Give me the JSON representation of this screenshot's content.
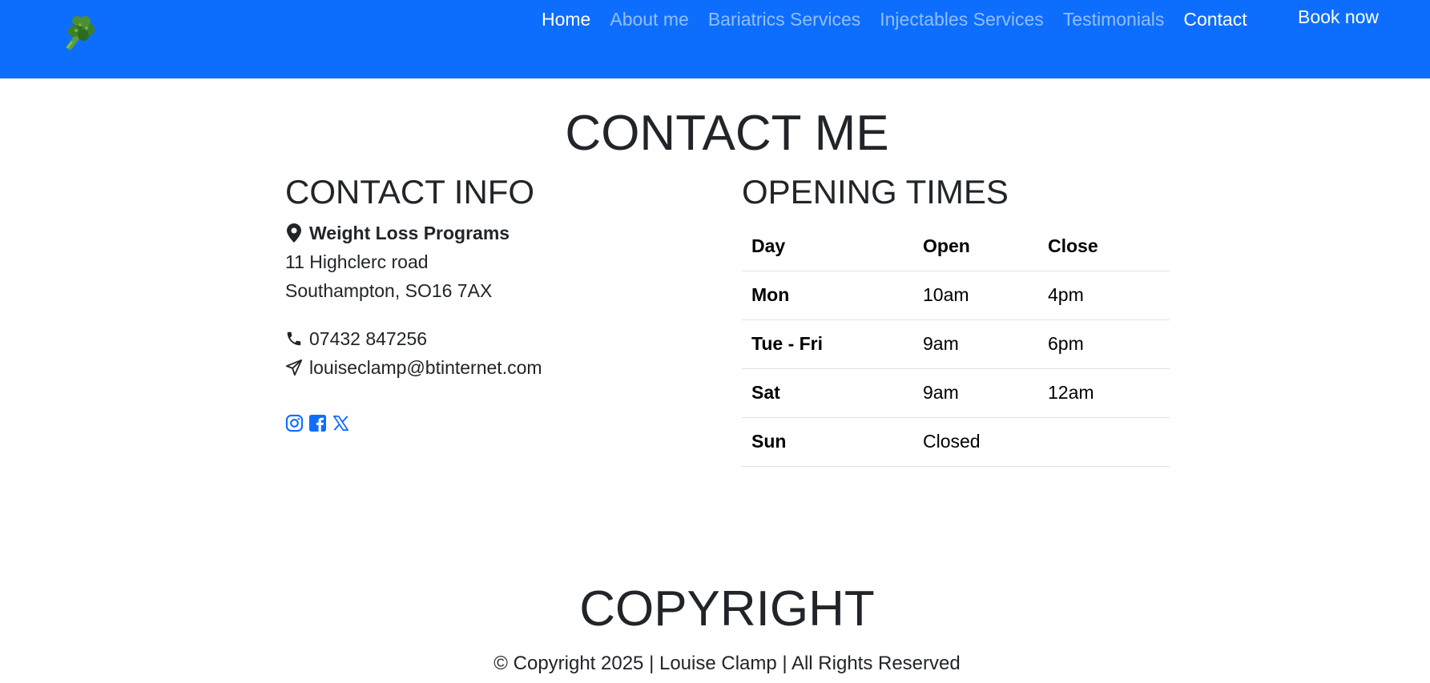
{
  "nav": {
    "logo_icon": "broccoli-icon",
    "links": [
      {
        "label": "Home",
        "active": true
      },
      {
        "label": "About me",
        "active": false
      },
      {
        "label": "Bariatrics Services",
        "active": false
      },
      {
        "label": "Injectables Services",
        "active": false
      },
      {
        "label": "Testimonials",
        "active": false
      },
      {
        "label": "Contact",
        "active": true
      }
    ],
    "book_label": "Book now",
    "background_color": "#0d6efd"
  },
  "page_title": "CONTACT ME",
  "contact": {
    "heading": "CONTACT INFO",
    "org_name": "Weight Loss Programs",
    "address_line1": "11 Highclerc road",
    "address_line2": "Southampton, SO16 7AX",
    "phone": "07432 847256",
    "email": "louiseclamp@btinternet.com",
    "icons": {
      "location": "map-pin-icon",
      "phone": "phone-icon",
      "email": "paper-plane-icon"
    },
    "social": [
      {
        "icon": "instagram-icon"
      },
      {
        "icon": "facebook-icon"
      },
      {
        "icon": "x-twitter-icon"
      }
    ],
    "social_color": "#0d6efd"
  },
  "hours": {
    "heading": "OPENING TIMES",
    "columns": [
      "Day",
      "Open",
      "Close"
    ],
    "rows": [
      {
        "day": "Mon",
        "open": "10am",
        "close": "4pm"
      },
      {
        "day": "Tue - Fri",
        "open": "9am",
        "close": "6pm"
      },
      {
        "day": "Sat",
        "open": "9am",
        "close": "12am"
      },
      {
        "day": "Sun",
        "open": "Closed",
        "close": ""
      }
    ]
  },
  "footer": {
    "heading": "COPYRIGHT",
    "text": "© Copyright 2025 | Louise Clamp | All Rights Reserved"
  }
}
